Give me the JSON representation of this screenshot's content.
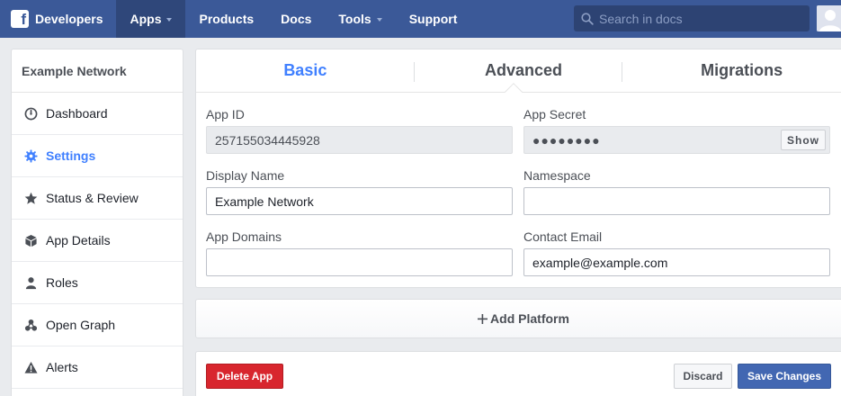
{
  "nav": {
    "brand": "Developers",
    "items": [
      {
        "label": "Apps",
        "active": true,
        "caret": true
      },
      {
        "label": "Products"
      },
      {
        "label": "Docs"
      },
      {
        "label": "Tools",
        "caret": true
      },
      {
        "label": "Support"
      }
    ],
    "search_placeholder": "Search in docs"
  },
  "sidebar": {
    "title": "Example Network",
    "items": [
      {
        "label": "Dashboard",
        "icon": "dashboard-icon"
      },
      {
        "label": "Settings",
        "icon": "gear-icon",
        "active": true
      },
      {
        "label": "Status & Review",
        "icon": "star-icon"
      },
      {
        "label": "App Details",
        "icon": "cube-icon"
      },
      {
        "label": "Roles",
        "icon": "person-icon"
      },
      {
        "label": "Open Graph",
        "icon": "graph-icon"
      },
      {
        "label": "Alerts",
        "icon": "warning-icon"
      }
    ]
  },
  "tabs": [
    {
      "label": "Basic",
      "active": true
    },
    {
      "label": "Advanced"
    },
    {
      "label": "Migrations"
    }
  ],
  "form": {
    "app_id_label": "App ID",
    "app_id_value": "257155034445928",
    "app_secret_label": "App Secret",
    "app_secret_value": "●●●●●●●●",
    "show_label": "Show",
    "display_name_label": "Display Name",
    "display_name_value": "Example Network",
    "namespace_label": "Namespace",
    "namespace_value": "",
    "app_domains_label": "App Domains",
    "app_domains_value": "",
    "contact_email_label": "Contact Email",
    "contact_email_value": "example@example.com"
  },
  "add_platform": "Add Platform",
  "actions": {
    "delete": "Delete App",
    "discard": "Discard",
    "save": "Save Changes"
  },
  "colors": {
    "nav_bg": "#3b5998",
    "accent": "#4080ff",
    "danger": "#d8262e",
    "primary": "#4267b2"
  }
}
